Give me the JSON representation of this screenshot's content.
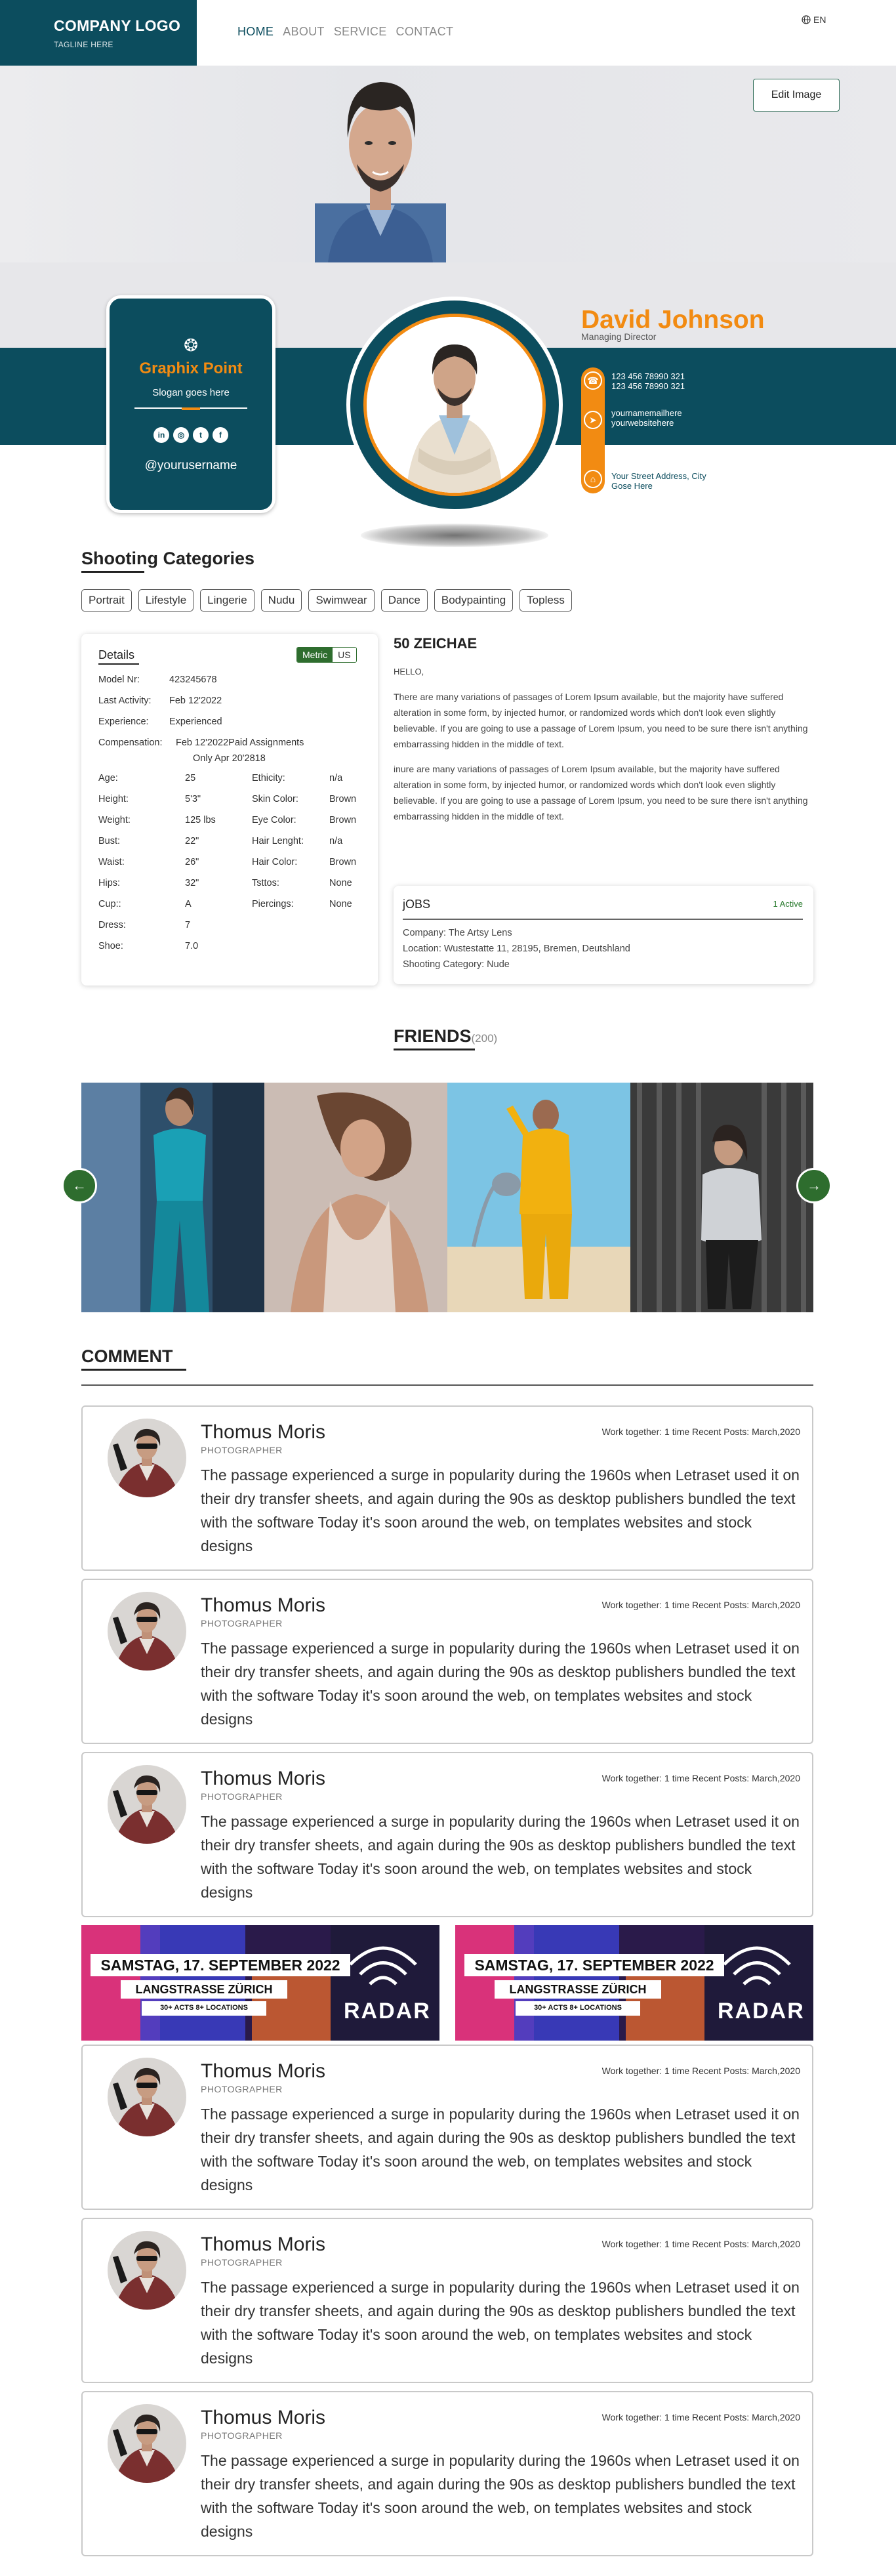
{
  "header": {
    "logo_title": "COMPANY LOGO",
    "logo_tagline": "TAGLINE HERE",
    "nav": [
      "HOME",
      "ABOUT",
      "SERVICE",
      "CONTACT"
    ],
    "language": "EN"
  },
  "hero": {
    "edit_label": "Edit Image"
  },
  "brand": {
    "name": "Graphix Point",
    "slogan": "Slogan goes here",
    "username": "@yourusername",
    "social_icons": [
      "linkedin-icon",
      "instagram-icon",
      "twitter-icon",
      "facebook-icon"
    ]
  },
  "profile": {
    "name": "David Johnson",
    "role": "Managing Director",
    "phone1": "123 456 78990 321",
    "phone2": "123 456 78990 321",
    "email": "yournamemailhere",
    "website": "yourwebsitehere",
    "address1": "Your Street Address, City",
    "address2": "Gose Here"
  },
  "categories": {
    "title": "Shooting Categories",
    "items": [
      "Portrait",
      "Lifestyle",
      "Lingerie",
      "Nudu",
      "Swimwear",
      "Dance",
      "Bodypainting",
      "Topless"
    ]
  },
  "details": {
    "title": "Details",
    "toggle": [
      "Metric",
      "US"
    ],
    "top": [
      {
        "k": "Model Nr:",
        "v": "423245678"
      },
      {
        "k": "Last Activity:",
        "v": "Feb 12'2022"
      },
      {
        "k": "Experience:",
        "v": "Experienced"
      },
      {
        "k": "Compensation:",
        "v": "Feb 12'2022Paid Assignments"
      }
    ],
    "compensation_extra": "Only Apr 20'2818",
    "left": [
      {
        "k": "Age:",
        "v": "25"
      },
      {
        "k": "Height:",
        "v": "5'3\""
      },
      {
        "k": "Weight:",
        "v": "125 lbs"
      },
      {
        "k": "Bust:",
        "v": "22\""
      },
      {
        "k": "Waist:",
        "v": "26\""
      },
      {
        "k": "Hips:",
        "v": "32\""
      },
      {
        "k": "Cup::",
        "v": "A"
      },
      {
        "k": "Dress:",
        "v": "7"
      },
      {
        "k": "Shoe:",
        "v": "7.0"
      }
    ],
    "right": [
      {
        "k": "Ethicity:",
        "v": "n/a"
      },
      {
        "k": "Skin Color:",
        "v": "Brown"
      },
      {
        "k": "Eye Color:",
        "v": "Brown"
      },
      {
        "k": "Hair Lenght:",
        "v": "n/a"
      },
      {
        "k": "Hair Color:",
        "v": "Brown"
      },
      {
        "k": "Tsttos:",
        "v": "None"
      },
      {
        "k": "Piercings:",
        "v": "None"
      }
    ]
  },
  "about": {
    "title": "50 ZEICHAE",
    "hello": "HELLO,",
    "p1": "There are many variations of passages of Lorem Ipsum available, but the majority have suffered alteration in some form, by injected humor, or randomized words which don't look even slightly believable. If you are going to use a passage of Lorem Ipsum, you need to be sure there isn't anything embarrassing hidden in the middle of text.",
    "p2": "inure are many variations of passages of Lorem Ipsum available, but the majority have suffered alteration in some form, by injected humor, or randomized words which don't look even slightly believable. If you are going to use a passage of Lorem Ipsum, you need to be sure there isn't anything embarrassing hidden in the middle of text."
  },
  "jobs": {
    "title": "jOBS",
    "active": "1 Active",
    "company": "Company:  The Artsy Lens",
    "location": "Location:  Wustestatte 11, 28195, Bremen, Deutshland",
    "category": "Shooting Category:  Nude"
  },
  "friends": {
    "title": "FRIENDS",
    "count": "(200)"
  },
  "comments": {
    "title": "COMMENT",
    "items": [
      {
        "name": "Thomus Moris",
        "role": "PHOTOGRAPHER",
        "meta": "Work together: 1 time  Recent Posts: March,2020",
        "text": "The passage experienced a surge in popularity during the 1960s when Letraset used it on their dry transfer sheets, and again during the 90s as desktop publishers bundled the text with the software Today it's soon around the web, on templates websites and stock designs"
      },
      {
        "name": "Thomus Moris",
        "role": "PHOTOGRAPHER",
        "meta": "Work together: 1 time  Recent Posts: March,2020",
        "text": "The passage experienced a surge in popularity during the 1960s when Letraset used it on their dry transfer sheets, and again during the 90s as desktop publishers bundled the text with the software Today it's soon around the web, on templates websites and stock designs"
      },
      {
        "name": "Thomus Moris",
        "role": "PHOTOGRAPHER",
        "meta": "Work together: 1 time  Recent Posts: March,2020",
        "text": "The passage experienced a surge in popularity during the 1960s when Letraset used it on their dry transfer sheets, and again during the 90s as desktop publishers bundled the text with the software Today it's soon around the web, on templates websites and stock designs"
      },
      {
        "name": "Thomus Moris",
        "role": "PHOTOGRAPHER",
        "meta": "Work together: 1 time  Recent Posts: March,2020",
        "text": "The passage experienced a surge in popularity during the 1960s when Letraset used it on their dry transfer sheets, and again during the 90s as desktop publishers bundled the text with the software Today it's soon around the web, on templates websites and stock designs"
      },
      {
        "name": "Thomus Moris",
        "role": "PHOTOGRAPHER",
        "meta": "Work together: 1 time  Recent Posts: March,2020",
        "text": "The passage experienced a surge in popularity during the 1960s when Letraset used it on their dry transfer sheets, and again during the 90s as desktop publishers bundled the text with the software Today it's soon around the web, on templates websites and stock designs"
      },
      {
        "name": "Thomus Moris",
        "role": "PHOTOGRAPHER",
        "meta": "Work together: 1 time  Recent Posts: March,2020",
        "text": "The passage experienced a surge in popularity during the 1960s when Letraset used it on their dry transfer sheets, and again during the 90s as desktop publishers bundled the text with the software Today it's soon around the web, on templates websites and stock designs"
      }
    ]
  },
  "banner": {
    "line1": "SAMSTAG, 17. SEPTEMBER 2022",
    "line2": "LANGSTRASSE ZÜRICH",
    "line3": "30+ ACTS   8+ LOCATIONS",
    "brand": "RADAR"
  },
  "colors": {
    "brand_teal": "#0c4d5e",
    "accent_orange": "#f28b12",
    "button_green": "#2e6d2e"
  }
}
